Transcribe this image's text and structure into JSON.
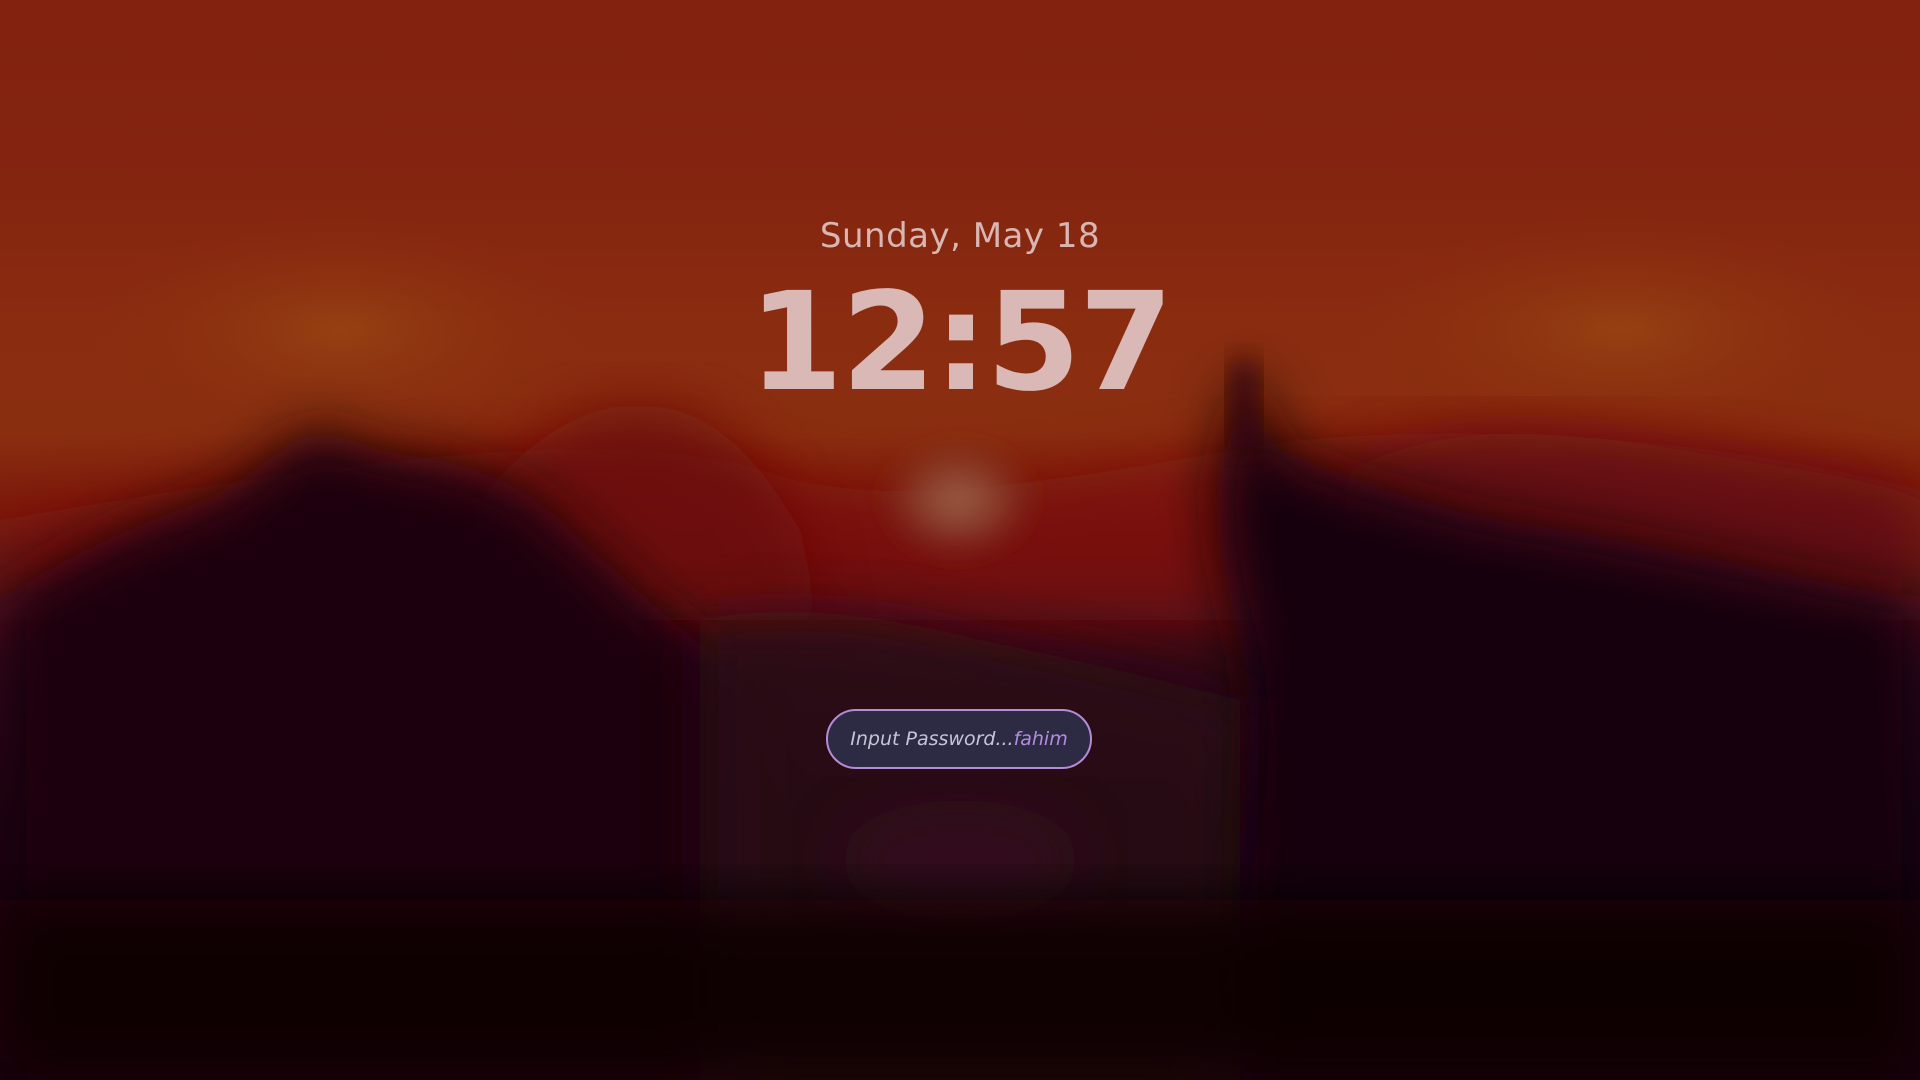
{
  "lockscreen": {
    "date": "Sunday, May 18",
    "time": "12:57",
    "password_field": {
      "placeholder": "Input Password...",
      "username": "fahim"
    }
  },
  "colors": {
    "sky_top": "#82220f",
    "ground": "#0f0206",
    "text": "#d9b8b5",
    "field_bg": "#2d2b43",
    "field_border": "#b78ad6",
    "username_accent": "#b48ce0"
  }
}
